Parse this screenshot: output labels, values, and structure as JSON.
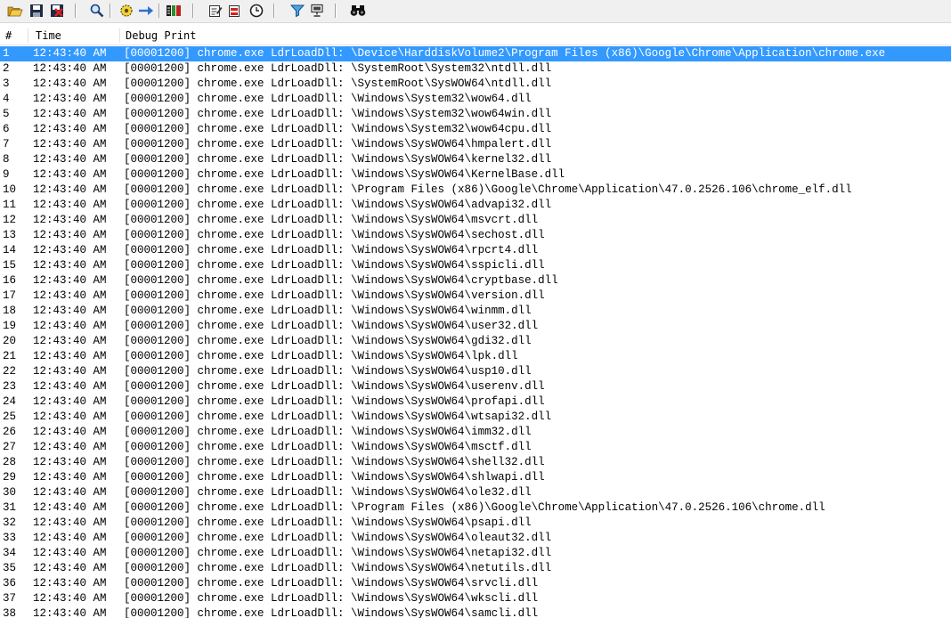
{
  "toolbar": {
    "buttons": [
      {
        "name": "open-icon",
        "tip": "Open"
      },
      {
        "name": "save-icon",
        "tip": "Save"
      },
      {
        "name": "clear-log-icon",
        "tip": "Clear"
      },
      {
        "name": "find-icon",
        "tip": "Find"
      },
      {
        "name": "capture-icon",
        "tip": "Capture"
      },
      {
        "name": "autoscroll-icon",
        "tip": "Autoscroll"
      },
      {
        "name": "process-list-icon",
        "tip": "Process"
      },
      {
        "name": "edit-filter-icon",
        "tip": "Filter"
      },
      {
        "name": "highlight-icon",
        "tip": "Highlight"
      },
      {
        "name": "clock-icon",
        "tip": "Clock"
      },
      {
        "name": "filter-funnel-icon",
        "tip": "Funnel"
      },
      {
        "name": "computer-icon",
        "tip": "Computer"
      },
      {
        "name": "binoculars-icon",
        "tip": "Binoculars"
      }
    ]
  },
  "columns": {
    "num": "#",
    "time": "Time",
    "debug": "Debug Print"
  },
  "colors": {
    "selection": "#3399ff",
    "selection_text": "#ffffff"
  },
  "selected_row": 1,
  "rows": [
    {
      "num": "1",
      "time": "12:43:40 AM",
      "msg": "[00001200] chrome.exe LdrLoadDll: \\Device\\HarddiskVolume2\\Program Files (x86)\\Google\\Chrome\\Application\\chrome.exe"
    },
    {
      "num": "2",
      "time": "12:43:40 AM",
      "msg": "[00001200] chrome.exe LdrLoadDll: \\SystemRoot\\System32\\ntdll.dll"
    },
    {
      "num": "3",
      "time": "12:43:40 AM",
      "msg": "[00001200] chrome.exe LdrLoadDll: \\SystemRoot\\SysWOW64\\ntdll.dll"
    },
    {
      "num": "4",
      "time": "12:43:40 AM",
      "msg": "[00001200] chrome.exe LdrLoadDll: \\Windows\\System32\\wow64.dll"
    },
    {
      "num": "5",
      "time": "12:43:40 AM",
      "msg": "[00001200] chrome.exe LdrLoadDll: \\Windows\\System32\\wow64win.dll"
    },
    {
      "num": "6",
      "time": "12:43:40 AM",
      "msg": "[00001200] chrome.exe LdrLoadDll: \\Windows\\System32\\wow64cpu.dll"
    },
    {
      "num": "7",
      "time": "12:43:40 AM",
      "msg": "[00001200] chrome.exe LdrLoadDll: \\Windows\\SysWOW64\\hmpalert.dll"
    },
    {
      "num": "8",
      "time": "12:43:40 AM",
      "msg": "[00001200] chrome.exe LdrLoadDll: \\Windows\\SysWOW64\\kernel32.dll"
    },
    {
      "num": "9",
      "time": "12:43:40 AM",
      "msg": "[00001200] chrome.exe LdrLoadDll: \\Windows\\SysWOW64\\KernelBase.dll"
    },
    {
      "num": "10",
      "time": "12:43:40 AM",
      "msg": "[00001200] chrome.exe LdrLoadDll: \\Program Files (x86)\\Google\\Chrome\\Application\\47.0.2526.106\\chrome_elf.dll"
    },
    {
      "num": "11",
      "time": "12:43:40 AM",
      "msg": "[00001200] chrome.exe LdrLoadDll: \\Windows\\SysWOW64\\advapi32.dll"
    },
    {
      "num": "12",
      "time": "12:43:40 AM",
      "msg": "[00001200] chrome.exe LdrLoadDll: \\Windows\\SysWOW64\\msvcrt.dll"
    },
    {
      "num": "13",
      "time": "12:43:40 AM",
      "msg": "[00001200] chrome.exe LdrLoadDll: \\Windows\\SysWOW64\\sechost.dll"
    },
    {
      "num": "14",
      "time": "12:43:40 AM",
      "msg": "[00001200] chrome.exe LdrLoadDll: \\Windows\\SysWOW64\\rpcrt4.dll"
    },
    {
      "num": "15",
      "time": "12:43:40 AM",
      "msg": "[00001200] chrome.exe LdrLoadDll: \\Windows\\SysWOW64\\sspicli.dll"
    },
    {
      "num": "16",
      "time": "12:43:40 AM",
      "msg": "[00001200] chrome.exe LdrLoadDll: \\Windows\\SysWOW64\\cryptbase.dll"
    },
    {
      "num": "17",
      "time": "12:43:40 AM",
      "msg": "[00001200] chrome.exe LdrLoadDll: \\Windows\\SysWOW64\\version.dll"
    },
    {
      "num": "18",
      "time": "12:43:40 AM",
      "msg": "[00001200] chrome.exe LdrLoadDll: \\Windows\\SysWOW64\\winmm.dll"
    },
    {
      "num": "19",
      "time": "12:43:40 AM",
      "msg": "[00001200] chrome.exe LdrLoadDll: \\Windows\\SysWOW64\\user32.dll"
    },
    {
      "num": "20",
      "time": "12:43:40 AM",
      "msg": "[00001200] chrome.exe LdrLoadDll: \\Windows\\SysWOW64\\gdi32.dll"
    },
    {
      "num": "21",
      "time": "12:43:40 AM",
      "msg": "[00001200] chrome.exe LdrLoadDll: \\Windows\\SysWOW64\\lpk.dll"
    },
    {
      "num": "22",
      "time": "12:43:40 AM",
      "msg": "[00001200] chrome.exe LdrLoadDll: \\Windows\\SysWOW64\\usp10.dll"
    },
    {
      "num": "23",
      "time": "12:43:40 AM",
      "msg": "[00001200] chrome.exe LdrLoadDll: \\Windows\\SysWOW64\\userenv.dll"
    },
    {
      "num": "24",
      "time": "12:43:40 AM",
      "msg": "[00001200] chrome.exe LdrLoadDll: \\Windows\\SysWOW64\\profapi.dll"
    },
    {
      "num": "25",
      "time": "12:43:40 AM",
      "msg": "[00001200] chrome.exe LdrLoadDll: \\Windows\\SysWOW64\\wtsapi32.dll"
    },
    {
      "num": "26",
      "time": "12:43:40 AM",
      "msg": "[00001200] chrome.exe LdrLoadDll: \\Windows\\SysWOW64\\imm32.dll"
    },
    {
      "num": "27",
      "time": "12:43:40 AM",
      "msg": "[00001200] chrome.exe LdrLoadDll: \\Windows\\SysWOW64\\msctf.dll"
    },
    {
      "num": "28",
      "time": "12:43:40 AM",
      "msg": "[00001200] chrome.exe LdrLoadDll: \\Windows\\SysWOW64\\shell32.dll"
    },
    {
      "num": "29",
      "time": "12:43:40 AM",
      "msg": "[00001200] chrome.exe LdrLoadDll: \\Windows\\SysWOW64\\shlwapi.dll"
    },
    {
      "num": "30",
      "time": "12:43:40 AM",
      "msg": "[00001200] chrome.exe LdrLoadDll: \\Windows\\SysWOW64\\ole32.dll"
    },
    {
      "num": "31",
      "time": "12:43:40 AM",
      "msg": "[00001200] chrome.exe LdrLoadDll: \\Program Files (x86)\\Google\\Chrome\\Application\\47.0.2526.106\\chrome.dll"
    },
    {
      "num": "32",
      "time": "12:43:40 AM",
      "msg": "[00001200] chrome.exe LdrLoadDll: \\Windows\\SysWOW64\\psapi.dll"
    },
    {
      "num": "33",
      "time": "12:43:40 AM",
      "msg": "[00001200] chrome.exe LdrLoadDll: \\Windows\\SysWOW64\\oleaut32.dll"
    },
    {
      "num": "34",
      "time": "12:43:40 AM",
      "msg": "[00001200] chrome.exe LdrLoadDll: \\Windows\\SysWOW64\\netapi32.dll"
    },
    {
      "num": "35",
      "time": "12:43:40 AM",
      "msg": "[00001200] chrome.exe LdrLoadDll: \\Windows\\SysWOW64\\netutils.dll"
    },
    {
      "num": "36",
      "time": "12:43:40 AM",
      "msg": "[00001200] chrome.exe LdrLoadDll: \\Windows\\SysWOW64\\srvcli.dll"
    },
    {
      "num": "37",
      "time": "12:43:40 AM",
      "msg": "[00001200] chrome.exe LdrLoadDll: \\Windows\\SysWOW64\\wkscli.dll"
    },
    {
      "num": "38",
      "time": "12:43:40 AM",
      "msg": "[00001200] chrome.exe LdrLoadDll: \\Windows\\SysWOW64\\samcli.dll"
    }
  ]
}
